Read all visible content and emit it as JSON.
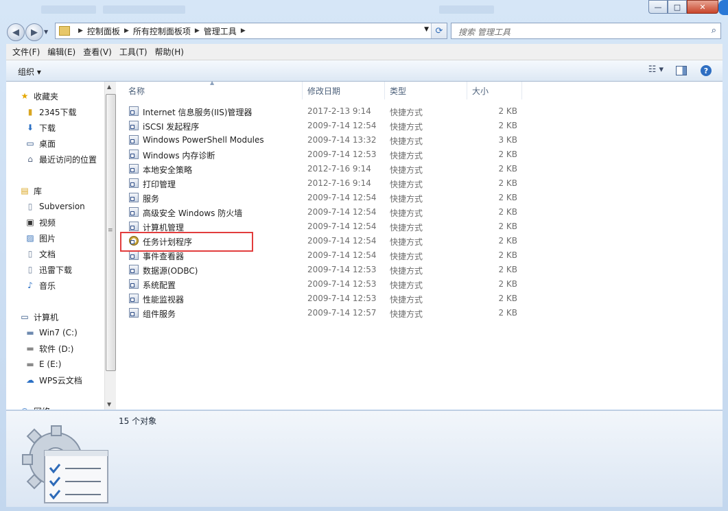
{
  "window": {
    "caption_buttons": {
      "minimize": "—",
      "maximize": "□",
      "close": "✕"
    }
  },
  "navigation": {
    "back_icon": "back-arrow-icon",
    "forward_icon": "forward-arrow-icon",
    "breadcrumb": [
      "控制面板",
      "所有控制面板项",
      "管理工具"
    ],
    "search_placeholder": "搜索 管理工具"
  },
  "menubar": [
    "文件(F)",
    "编辑(E)",
    "查看(V)",
    "工具(T)",
    "帮助(H)"
  ],
  "toolbar": {
    "organize": "组织 ▾",
    "help": "?"
  },
  "sidebar": {
    "favorites": {
      "title": "收藏夹",
      "items": [
        "2345下载",
        "下载",
        "桌面",
        "最近访问的位置"
      ]
    },
    "libraries": {
      "title": "库",
      "items": [
        "Subversion",
        "视频",
        "图片",
        "文档",
        "迅雷下载",
        "音乐"
      ]
    },
    "computer": {
      "title": "计算机",
      "items": [
        "Win7 (C:)",
        "软件 (D:)",
        "E (E:)",
        "WPS云文档"
      ]
    },
    "network": {
      "title": "网络"
    }
  },
  "columns": {
    "name": "名称",
    "modified": "修改日期",
    "type": "类型",
    "size": "大小"
  },
  "files": [
    {
      "name": "Internet 信息服务(IIS)管理器",
      "modified": "2017-2-13 9:14",
      "type": "快捷方式",
      "size": "2 KB"
    },
    {
      "name": "iSCSI 发起程序",
      "modified": "2009-7-14 12:54",
      "type": "快捷方式",
      "size": "2 KB"
    },
    {
      "name": "Windows PowerShell Modules",
      "modified": "2009-7-14 13:32",
      "type": "快捷方式",
      "size": "3 KB"
    },
    {
      "name": "Windows 内存诊断",
      "modified": "2009-7-14 12:53",
      "type": "快捷方式",
      "size": "2 KB"
    },
    {
      "name": "本地安全策略",
      "modified": "2012-7-16 9:14",
      "type": "快捷方式",
      "size": "2 KB"
    },
    {
      "name": "打印管理",
      "modified": "2012-7-16 9:14",
      "type": "快捷方式",
      "size": "2 KB"
    },
    {
      "name": "服务",
      "modified": "2009-7-14 12:54",
      "type": "快捷方式",
      "size": "2 KB"
    },
    {
      "name": "高级安全 Windows 防火墙",
      "modified": "2009-7-14 12:54",
      "type": "快捷方式",
      "size": "2 KB"
    },
    {
      "name": "计算机管理",
      "modified": "2009-7-14 12:54",
      "type": "快捷方式",
      "size": "2 KB"
    },
    {
      "name": "任务计划程序",
      "modified": "2009-7-14 12:54",
      "type": "快捷方式",
      "size": "2 KB"
    },
    {
      "name": "事件查看器",
      "modified": "2009-7-14 12:54",
      "type": "快捷方式",
      "size": "2 KB"
    },
    {
      "name": "数据源(ODBC)",
      "modified": "2009-7-14 12:53",
      "type": "快捷方式",
      "size": "2 KB"
    },
    {
      "name": "系统配置",
      "modified": "2009-7-14 12:53",
      "type": "快捷方式",
      "size": "2 KB"
    },
    {
      "name": "性能监视器",
      "modified": "2009-7-14 12:53",
      "type": "快捷方式",
      "size": "2 KB"
    },
    {
      "name": "组件服务",
      "modified": "2009-7-14 12:57",
      "type": "快捷方式",
      "size": "2 KB"
    }
  ],
  "highlighted_item": "任务计划程序",
  "details_pane": {
    "count": "15 个对象"
  },
  "colors": {
    "highlight": "#e23c3c",
    "accent": "#2d6ab8"
  }
}
